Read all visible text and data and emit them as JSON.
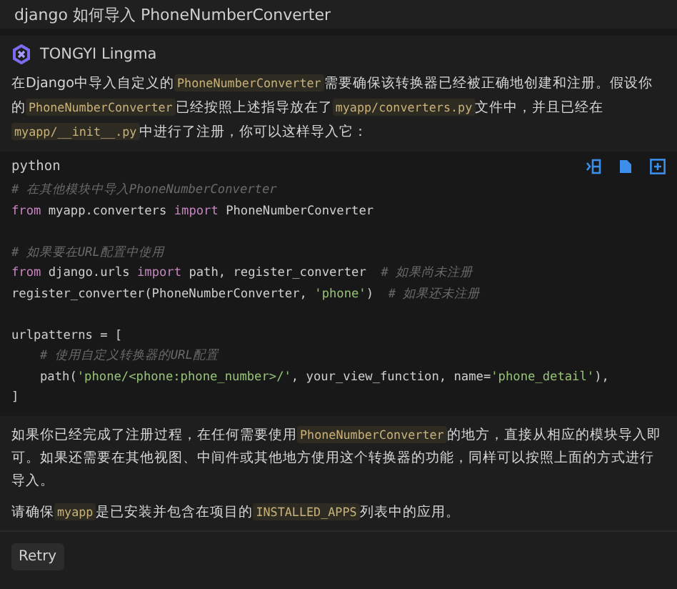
{
  "question": {
    "title": "django 如何导入 PhoneNumberConverter"
  },
  "assistant": {
    "name": "TONGYI Lingma"
  },
  "intro": [
    {
      "kind": "text",
      "text": "在Django中导入自定义的"
    },
    {
      "kind": "code",
      "text": "PhoneNumberConverter"
    },
    {
      "kind": "text",
      "text": "需要确保该转换器已经被正确地创建和注册。假设你的"
    },
    {
      "kind": "code",
      "text": "PhoneNumberConverter"
    },
    {
      "kind": "text",
      "text": "已经按照上述指导放在了"
    },
    {
      "kind": "code",
      "text": "myapp/converters.py"
    },
    {
      "kind": "text",
      "text": "文件中，并且已经在"
    },
    {
      "kind": "code",
      "text": "myapp/__init__.py"
    },
    {
      "kind": "text",
      "text": "中进行了注册，你可以这样导入它："
    }
  ],
  "code_block": {
    "language": "python",
    "lines": [
      {
        "kind": "code",
        "indented": false,
        "tokens": [
          {
            "kind": "comment",
            "text": "# 在其他模块中导入PhoneNumberConverter"
          }
        ]
      },
      {
        "kind": "code",
        "indented": false,
        "tokens": [
          {
            "kind": "keyword",
            "text": "from"
          },
          {
            "kind": "plain",
            "text": " myapp.converters "
          },
          {
            "kind": "keyword",
            "text": "import"
          },
          {
            "kind": "plain",
            "text": " PhoneNumberConverter"
          }
        ]
      },
      {
        "kind": "blank"
      },
      {
        "kind": "code",
        "indented": false,
        "tokens": [
          {
            "kind": "comment",
            "text": "# 如果要在URL配置中使用"
          }
        ]
      },
      {
        "kind": "code",
        "indented": false,
        "tokens": [
          {
            "kind": "keyword",
            "text": "from"
          },
          {
            "kind": "plain",
            "text": " django.urls "
          },
          {
            "kind": "keyword",
            "text": "import"
          },
          {
            "kind": "plain",
            "text": " path, register_converter  "
          },
          {
            "kind": "comment",
            "text": "# 如果尚未注册"
          }
        ]
      },
      {
        "kind": "code",
        "indented": false,
        "tokens": [
          {
            "kind": "plain",
            "text": "register_converter(PhoneNumberConverter, "
          },
          {
            "kind": "string",
            "text": "'phone'"
          },
          {
            "kind": "plain",
            "text": ")  "
          },
          {
            "kind": "comment",
            "text": "# 如果还未注册"
          }
        ]
      },
      {
        "kind": "blank"
      },
      {
        "kind": "code",
        "indented": false,
        "tokens": [
          {
            "kind": "plain",
            "text": "urlpatterns = ["
          }
        ]
      },
      {
        "kind": "code",
        "indented": true,
        "tokens": [
          {
            "kind": "comment",
            "text": "# 使用自定义转换器的URL配置"
          }
        ]
      },
      {
        "kind": "code",
        "indented": true,
        "tokens": [
          {
            "kind": "plain",
            "text": "path("
          },
          {
            "kind": "string",
            "text": "'phone/<phone:phone_number>/'"
          },
          {
            "kind": "plain",
            "text": ", your_view_function, name="
          },
          {
            "kind": "string",
            "text": "'phone_detail'"
          },
          {
            "kind": "plain",
            "text": "),"
          }
        ]
      },
      {
        "kind": "code",
        "indented": false,
        "tokens": [
          {
            "kind": "plain",
            "text": "]"
          }
        ]
      }
    ]
  },
  "outro": [
    [
      {
        "kind": "text",
        "text": "如果你已经完成了注册过程，在任何需要使用"
      },
      {
        "kind": "code",
        "text": "PhoneNumberConverter"
      },
      {
        "kind": "text",
        "text": "的地方，直接从相应的模块导入即可。如果还需要在其他视图、中间件或其他地方使用这个转换器的功能，同样可以按照上面的方式进行导入。"
      }
    ],
    [
      {
        "kind": "text",
        "text": "请确保"
      },
      {
        "kind": "code",
        "text": "myapp"
      },
      {
        "kind": "text",
        "text": "是已安装并包含在项目的"
      },
      {
        "kind": "code",
        "text": "INSTALLED_APPS"
      },
      {
        "kind": "text",
        "text": "列表中的应用。"
      }
    ]
  ],
  "actions": [
    {
      "label": "Retry"
    }
  ]
}
